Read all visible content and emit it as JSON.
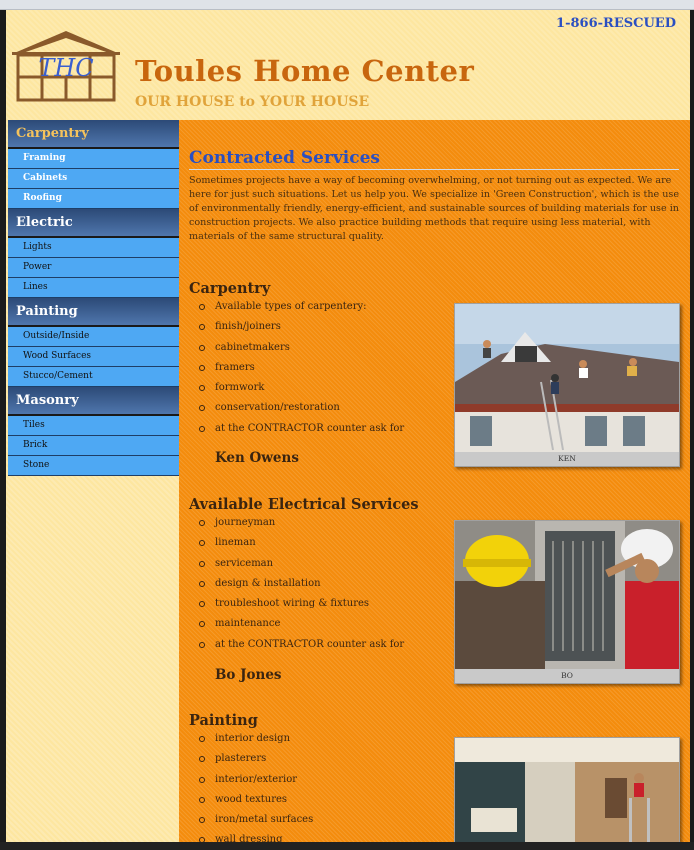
{
  "header": {
    "phone": "1-866-RESCUED",
    "logo_text": "THC",
    "site_title": "Toules Home Center",
    "tagline": "OUR HOUSE to YOUR HOUSE"
  },
  "sidebar": {
    "groups": [
      {
        "label": "Carpentry",
        "items": [
          "Framing",
          "Cabinets",
          "Roofing"
        ]
      },
      {
        "label": "Electric",
        "items": [
          "Lights",
          "Power",
          "Lines"
        ]
      },
      {
        "label": "Painting",
        "items": [
          "Outside/Inside",
          "Wood Surfaces",
          "Stucco/Cement"
        ]
      },
      {
        "label": "Masonry",
        "items": [
          "Tiles",
          "Brick",
          "Stone"
        ]
      }
    ]
  },
  "main": {
    "title": "Contracted Services",
    "intro": "Sometimes projects have a way of becoming overwhelming, or not turning out as expected. We are here for just such situations. Let us help you. We specialize in 'Green Construction', which is the use of environmentally friendly, energy-efficient, and sustainable sources of building materials for use in construction projects. We also practice building methods that require using less material, with materials of the same structural quality.",
    "sections": [
      {
        "title": "Carpentry",
        "items": [
          "Available types of carpentery:",
          "finish/joiners",
          "cabinetmakers",
          "framers",
          "formwork",
          "conservation/restoration",
          "at the CONTRACTOR counter ask for"
        ],
        "contact": "Ken Owens",
        "photo_caption": "KEN"
      },
      {
        "title": "Available Electrical Services",
        "items": [
          "journeyman",
          "lineman",
          "serviceman",
          "design & installation",
          "troubleshoot wiring & fixtures",
          "maintenance",
          "at the CONTRACTOR counter ask for"
        ],
        "contact": "Bo Jones",
        "photo_caption": "BO"
      },
      {
        "title": "Painting",
        "items": [
          "interior design",
          "plasterers",
          "interior/exterior",
          "wood textures",
          "iron/metal surfaces",
          "wall dressing"
        ],
        "contact": "",
        "photo_caption": ""
      }
    ]
  },
  "colors": {
    "page_bg": "#fde6a0",
    "main_bg": "#f48c0d",
    "title_orange": "#c8660e",
    "link_blue": "#2a4fc1",
    "nav_head": "#2c4a77",
    "nav_item": "#4ea8f3"
  }
}
